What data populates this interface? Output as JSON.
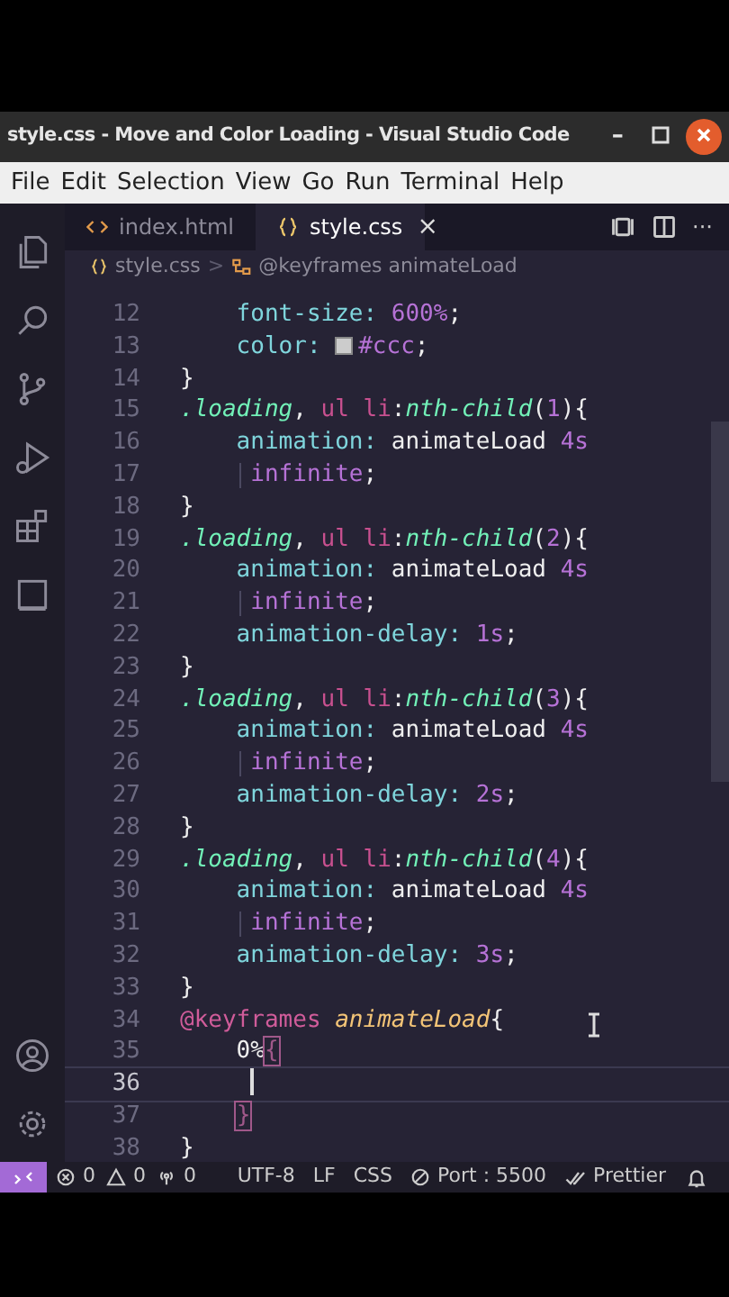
{
  "window": {
    "title": "style.css - Move and Color Loading - Visual Studio Code",
    "controls": [
      {
        "kind": "minimize",
        "label": "–"
      },
      {
        "kind": "maximize"
      },
      {
        "kind": "close"
      }
    ]
  },
  "menu": [
    "File",
    "Edit",
    "Selection",
    "View",
    "Go",
    "Run",
    "Terminal",
    "Help"
  ],
  "activity_bar": [
    {
      "kind": "files"
    },
    {
      "kind": "search"
    },
    {
      "kind": "source-control"
    },
    {
      "kind": "run"
    },
    {
      "kind": "extensions"
    },
    {
      "kind": "remote"
    },
    {
      "kind": "account"
    },
    {
      "kind": "settings"
    }
  ],
  "tabs": [
    {
      "label": "index.html",
      "kind": "html",
      "selected": false
    },
    {
      "label": "style.css",
      "kind": "css",
      "selected": true,
      "close": "×"
    }
  ],
  "editor_actions": [
    {
      "kind": "layout"
    },
    {
      "kind": "split"
    },
    {
      "kind": "more",
      "label": "···"
    }
  ],
  "breadcrumb": [
    {
      "label": "style.css",
      "kind": "file"
    },
    {
      "label": ">",
      "kind": "sep"
    },
    {
      "label": "@keyframes animateLoad",
      "kind": "symbol"
    }
  ],
  "code": [
    {
      "number": "12",
      "tokens": [
        {
          "kind": "prop",
          "text": "    font-size"
        },
        {
          "kind": "prop",
          "text": ":"
        },
        {
          "kind": "num",
          "text": " 600%"
        },
        {
          "kind": "punct",
          "text": ";"
        }
      ]
    },
    {
      "number": "13",
      "tokens": [
        {
          "kind": "prop",
          "text": "    color"
        },
        {
          "kind": "prop",
          "text": ": "
        },
        {
          "kind": "swatch",
          "color": "#cccccc"
        },
        {
          "kind": "num",
          "text": "#ccc"
        },
        {
          "kind": "punct",
          "text": ";"
        }
      ]
    },
    {
      "number": "14",
      "tokens": [
        {
          "kind": "punct",
          "text": "}"
        }
      ]
    },
    {
      "number": "15",
      "tokens": [
        {
          "kind": "sel",
          "text": ".loading"
        },
        {
          "kind": "punct",
          "text": ", "
        },
        {
          "kind": "tag",
          "text": "ul li"
        },
        {
          "kind": "punct",
          "text": ":"
        },
        {
          "kind": "sel",
          "text": "nth-child"
        },
        {
          "kind": "punct",
          "text": "("
        },
        {
          "kind": "num",
          "text": "1"
        },
        {
          "kind": "punct",
          "text": "){"
        }
      ]
    },
    {
      "number": "16",
      "tokens": [
        {
          "kind": "prop",
          "text": "    animation"
        },
        {
          "kind": "prop",
          "text": ":"
        },
        {
          "kind": "plain",
          "text": " animateLoad "
        },
        {
          "kind": "num",
          "text": "4s"
        }
      ]
    },
    {
      "number": "17",
      "wrapped": true,
      "tokens": [
        {
          "kind": "num",
          "text": "     infinite"
        },
        {
          "kind": "punct",
          "text": ";"
        }
      ]
    },
    {
      "number": "18",
      "tokens": [
        {
          "kind": "punct",
          "text": "}"
        }
      ]
    },
    {
      "number": "19",
      "tokens": [
        {
          "kind": "sel",
          "text": ".loading"
        },
        {
          "kind": "punct",
          "text": ", "
        },
        {
          "kind": "tag",
          "text": "ul li"
        },
        {
          "kind": "punct",
          "text": ":"
        },
        {
          "kind": "sel",
          "text": "nth-child"
        },
        {
          "kind": "punct",
          "text": "("
        },
        {
          "kind": "num",
          "text": "2"
        },
        {
          "kind": "punct",
          "text": "){"
        }
      ]
    },
    {
      "number": "20",
      "tokens": [
        {
          "kind": "prop",
          "text": "    animation"
        },
        {
          "kind": "prop",
          "text": ":"
        },
        {
          "kind": "plain",
          "text": " animateLoad "
        },
        {
          "kind": "num",
          "text": "4s"
        }
      ]
    },
    {
      "number": "21",
      "wrapped": true,
      "tokens": [
        {
          "kind": "num",
          "text": "     infinite"
        },
        {
          "kind": "punct",
          "text": ";"
        }
      ]
    },
    {
      "number": "22",
      "tokens": [
        {
          "kind": "prop",
          "text": "    animation-delay"
        },
        {
          "kind": "prop",
          "text": ":"
        },
        {
          "kind": "num",
          "text": " 1s"
        },
        {
          "kind": "punct",
          "text": ";"
        }
      ]
    },
    {
      "number": "23",
      "tokens": [
        {
          "kind": "punct",
          "text": "}"
        }
      ]
    },
    {
      "number": "24",
      "tokens": [
        {
          "kind": "sel",
          "text": ".loading"
        },
        {
          "kind": "punct",
          "text": ", "
        },
        {
          "kind": "tag",
          "text": "ul li"
        },
        {
          "kind": "punct",
          "text": ":"
        },
        {
          "kind": "sel",
          "text": "nth-child"
        },
        {
          "kind": "punct",
          "text": "("
        },
        {
          "kind": "num",
          "text": "3"
        },
        {
          "kind": "punct",
          "text": "){"
        }
      ]
    },
    {
      "number": "25",
      "tokens": [
        {
          "kind": "prop",
          "text": "    animation"
        },
        {
          "kind": "prop",
          "text": ":"
        },
        {
          "kind": "plain",
          "text": " animateLoad "
        },
        {
          "kind": "num",
          "text": "4s"
        }
      ]
    },
    {
      "number": "26",
      "wrapped": true,
      "tokens": [
        {
          "kind": "num",
          "text": "     infinite"
        },
        {
          "kind": "punct",
          "text": ";"
        }
      ]
    },
    {
      "number": "27",
      "tokens": [
        {
          "kind": "prop",
          "text": "    animation-delay"
        },
        {
          "kind": "prop",
          "text": ":"
        },
        {
          "kind": "num",
          "text": " 2s"
        },
        {
          "kind": "punct",
          "text": ";"
        }
      ]
    },
    {
      "number": "28",
      "tokens": [
        {
          "kind": "punct",
          "text": "}"
        }
      ]
    },
    {
      "number": "29",
      "tokens": [
        {
          "kind": "sel",
          "text": ".loading"
        },
        {
          "kind": "punct",
          "text": ", "
        },
        {
          "kind": "tag",
          "text": "ul li"
        },
        {
          "kind": "punct",
          "text": ":"
        },
        {
          "kind": "sel",
          "text": "nth-child"
        },
        {
          "kind": "punct",
          "text": "("
        },
        {
          "kind": "num",
          "text": "4"
        },
        {
          "kind": "punct",
          "text": "){"
        }
      ]
    },
    {
      "number": "30",
      "tokens": [
        {
          "kind": "prop",
          "text": "    animation"
        },
        {
          "kind": "prop",
          "text": ":"
        },
        {
          "kind": "plain",
          "text": " animateLoad "
        },
        {
          "kind": "num",
          "text": "4s"
        }
      ]
    },
    {
      "number": "31",
      "wrapped": true,
      "tokens": [
        {
          "kind": "num",
          "text": "     infinite"
        },
        {
          "kind": "punct",
          "text": ";"
        }
      ]
    },
    {
      "number": "32",
      "tokens": [
        {
          "kind": "prop",
          "text": "    animation-delay"
        },
        {
          "kind": "prop",
          "text": ":"
        },
        {
          "kind": "num",
          "text": " 3s"
        },
        {
          "kind": "punct",
          "text": ";"
        }
      ]
    },
    {
      "number": "33",
      "tokens": [
        {
          "kind": "punct",
          "text": "}"
        }
      ]
    },
    {
      "number": "34",
      "tokens": [
        {
          "kind": "at",
          "text": "@keyframes"
        },
        {
          "kind": "name",
          "text": " animateLoad"
        },
        {
          "kind": "punct",
          "text": "{"
        }
      ]
    },
    {
      "number": "35",
      "tokens": [
        {
          "kind": "plain",
          "text": "    0%"
        },
        {
          "kind": "bracket",
          "text": "{"
        }
      ]
    },
    {
      "number": "36",
      "current": true
    },
    {
      "number": "37",
      "tokens": [
        {
          "kind": "bracket",
          "text": "    }"
        }
      ]
    },
    {
      "number": "38",
      "tokens": [
        {
          "kind": "punct",
          "text": "}"
        }
      ]
    }
  ],
  "status_bar": {
    "items": [
      {
        "kind": "errors",
        "text": "0"
      },
      {
        "kind": "warnings",
        "text": "0"
      },
      {
        "kind": "ports",
        "text": "0"
      },
      {
        "kind": "spacer"
      },
      {
        "kind": "plain",
        "text": "UTF-8"
      },
      {
        "kind": "plain",
        "text": "LF"
      },
      {
        "kind": "plain",
        "text": "CSS"
      },
      {
        "kind": "port",
        "text": "Port : 5500"
      },
      {
        "kind": "prettier",
        "text": "Prettier"
      },
      {
        "kind": "bell"
      }
    ]
  }
}
